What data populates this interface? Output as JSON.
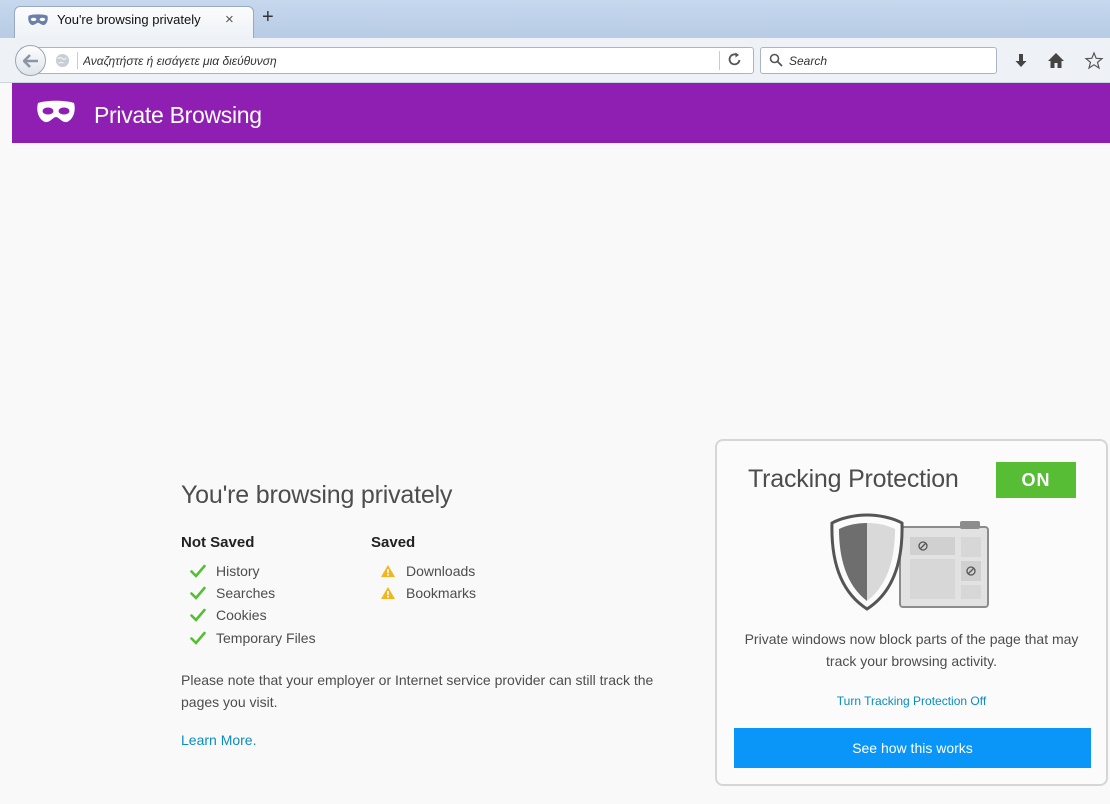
{
  "tab": {
    "title": "You're browsing privately",
    "close": "×",
    "new_tab": "+"
  },
  "navbar": {
    "url_placeholder": "Αναζητήστε ή εισάγετε μια διεύθυνση",
    "search_placeholder": "Search",
    "icons": [
      "back-arrow-icon",
      "globe-icon",
      "reload-icon",
      "search-icon",
      "download-icon",
      "home-icon",
      "bookmark-star-icon"
    ]
  },
  "banner": {
    "title": "Private Browsing",
    "color": "#8f1fb2",
    "icon": "mask-icon"
  },
  "main": {
    "heading": "You're browsing privately",
    "not_saved": {
      "title": "Not Saved",
      "items": [
        "History",
        "Searches",
        "Cookies",
        "Temporary Files"
      ]
    },
    "saved": {
      "title": "Saved",
      "items": [
        "Downloads",
        "Bookmarks"
      ]
    },
    "note": "Please note that your employer or Internet service provider can still track the pages you visit.",
    "learn_more": "Learn More."
  },
  "tracking": {
    "title": "Tracking Protection",
    "status": "ON",
    "status_color": "#57bd35",
    "description": "Private windows now block parts of the page that may track your browsing activity.",
    "turn_off": "Turn Tracking Protection Off",
    "see_how": "See how this works",
    "button_color": "#0996f8"
  }
}
